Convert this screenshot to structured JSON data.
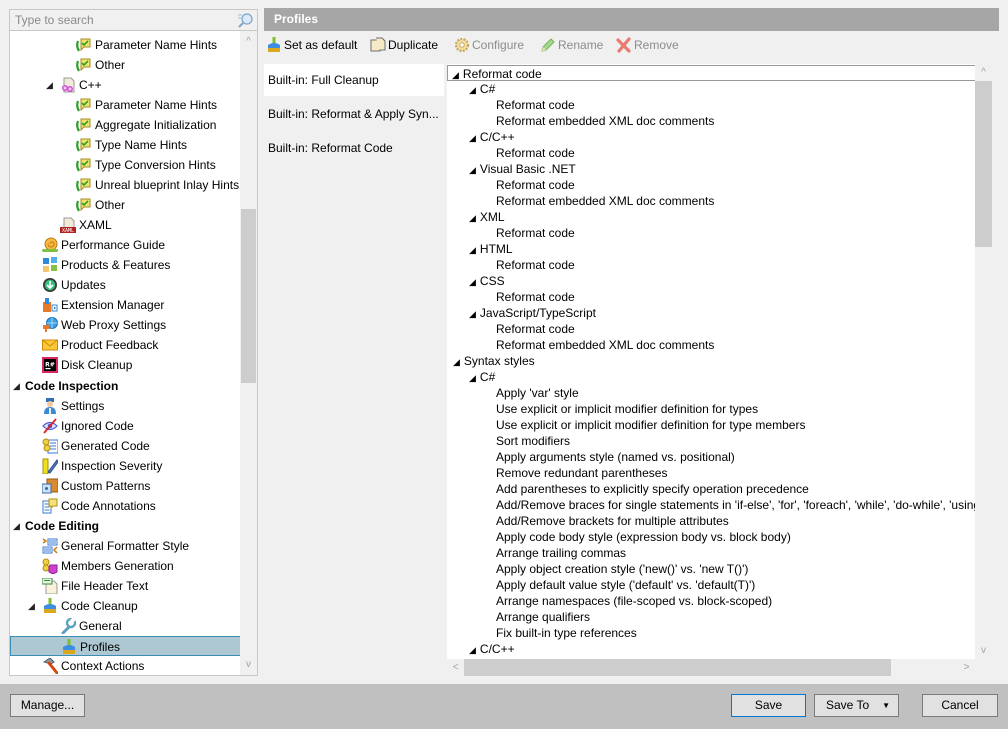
{
  "search": {
    "placeholder": "Type to search"
  },
  "tree": [
    {
      "label": "Parameter Name Hints",
      "icon": "inlay-hints-icon",
      "level": 3
    },
    {
      "label": "Other",
      "icon": "inlay-hints-icon",
      "level": 3
    },
    {
      "label": "C++",
      "icon": "cpp-file-icon",
      "level": 2,
      "expanded": true
    },
    {
      "label": "Parameter Name Hints",
      "icon": "inlay-hints-icon",
      "level": 3
    },
    {
      "label": "Aggregate Initialization",
      "icon": "inlay-hints-icon",
      "level": 3
    },
    {
      "label": "Type Name Hints",
      "icon": "inlay-hints-icon",
      "level": 3
    },
    {
      "label": "Type Conversion Hints",
      "icon": "inlay-hints-icon",
      "level": 3
    },
    {
      "label": "Unreal blueprint Inlay Hints",
      "icon": "inlay-hints-icon",
      "level": 3
    },
    {
      "label": "Other",
      "icon": "inlay-hints-icon",
      "level": 3
    },
    {
      "label": "XAML",
      "icon": "xaml-file-icon",
      "level": 2
    },
    {
      "label": "Performance Guide",
      "icon": "snail-icon",
      "level": 1
    },
    {
      "label": "Products & Features",
      "icon": "products-grid-icon",
      "level": 1
    },
    {
      "label": "Updates",
      "icon": "download-circle-icon",
      "level": 1
    },
    {
      "label": "Extension Manager",
      "icon": "extension-icon",
      "level": 1
    },
    {
      "label": "Web Proxy Settings",
      "icon": "globe-plug-icon",
      "level": 1
    },
    {
      "label": "Product Feedback",
      "icon": "envelope-icon",
      "level": 1
    },
    {
      "label": "Disk Cleanup",
      "icon": "resharper-icon",
      "level": 1
    },
    {
      "label": "Code Inspection",
      "level": 0,
      "expanded": true,
      "bold": true
    },
    {
      "label": "Settings",
      "icon": "inspector-icon",
      "level": 1
    },
    {
      "label": "Ignored Code",
      "icon": "eye-crossed-icon",
      "level": 1
    },
    {
      "label": "Generated Code",
      "icon": "generated-code-icon",
      "level": 1
    },
    {
      "label": "Inspection Severity",
      "icon": "severity-brush-icon",
      "level": 1
    },
    {
      "label": "Custom Patterns",
      "icon": "patterns-icon",
      "level": 1
    },
    {
      "label": "Code Annotations",
      "icon": "annotation-icon",
      "level": 1
    },
    {
      "label": "Code Editing",
      "level": 0,
      "expanded": true,
      "bold": true
    },
    {
      "label": "General Formatter Style",
      "icon": "formatter-icon",
      "level": 1
    },
    {
      "label": "Members Generation",
      "icon": "members-generation-icon",
      "level": 1
    },
    {
      "label": "File Header Text",
      "icon": "file-header-icon",
      "level": 1
    },
    {
      "label": "Code Cleanup",
      "icon": "broom-icon",
      "level": 1,
      "expanded": true,
      "has_arrow": true
    },
    {
      "label": "General",
      "icon": "wrench-icon",
      "level": 2
    },
    {
      "label": "Profiles",
      "icon": "broom-icon",
      "level": 2,
      "selected": true
    },
    {
      "label": "Context Actions",
      "icon": "hammer-icon",
      "level": 1
    }
  ],
  "panel": {
    "title": "Profiles"
  },
  "toolbar": {
    "set_default": "Set as default",
    "duplicate": "Duplicate",
    "configure": "Configure",
    "rename": "Rename",
    "remove": "Remove"
  },
  "profiles": [
    {
      "label": "Built-in: Full Cleanup",
      "active": true
    },
    {
      "label": "Built-in: Reformat & Apply Syn...",
      "active": false
    },
    {
      "label": "Built-in: Reformat Code",
      "active": false
    }
  ],
  "details": [
    {
      "text": "Reformat code",
      "level": 0,
      "arrow": true,
      "focused": true
    },
    {
      "text": "C#",
      "level": 1,
      "arrow": true
    },
    {
      "text": "Reformat code",
      "level": 2
    },
    {
      "text": "Reformat embedded XML doc comments",
      "level": 2
    },
    {
      "text": "C/C++",
      "level": 1,
      "arrow": true
    },
    {
      "text": "Reformat code",
      "level": 2
    },
    {
      "text": "Visual Basic .NET",
      "level": 1,
      "arrow": true
    },
    {
      "text": "Reformat code",
      "level": 2
    },
    {
      "text": "Reformat embedded XML doc comments",
      "level": 2
    },
    {
      "text": "XML",
      "level": 1,
      "arrow": true
    },
    {
      "text": "Reformat code",
      "level": 2
    },
    {
      "text": "HTML",
      "level": 1,
      "arrow": true
    },
    {
      "text": "Reformat code",
      "level": 2
    },
    {
      "text": "CSS",
      "level": 1,
      "arrow": true
    },
    {
      "text": "Reformat code",
      "level": 2
    },
    {
      "text": "JavaScript/TypeScript",
      "level": 1,
      "arrow": true
    },
    {
      "text": "Reformat code",
      "level": 2
    },
    {
      "text": "Reformat embedded XML doc comments",
      "level": 2
    },
    {
      "text": "Syntax styles",
      "level": 0,
      "arrow": true
    },
    {
      "text": "C#",
      "level": 1,
      "arrow": true
    },
    {
      "text": "Apply 'var' style",
      "level": 2
    },
    {
      "text": "Use explicit or implicit modifier definition for types",
      "level": 2
    },
    {
      "text": "Use explicit or implicit modifier definition for type members",
      "level": 2
    },
    {
      "text": "Sort modifiers",
      "level": 2
    },
    {
      "text": "Apply arguments style (named vs. positional)",
      "level": 2
    },
    {
      "text": "Remove redundant parentheses",
      "level": 2
    },
    {
      "text": "Add parentheses to explicitly specify operation precedence",
      "level": 2
    },
    {
      "text": "Add/Remove braces for single statements in 'if-else', 'for', 'foreach', 'while', 'do-while', 'using'",
      "level": 2
    },
    {
      "text": "Add/Remove brackets for multiple attributes",
      "level": 2
    },
    {
      "text": "Apply code body style (expression body vs. block body)",
      "level": 2
    },
    {
      "text": "Arrange trailing commas",
      "level": 2
    },
    {
      "text": "Apply object creation style ('new()' vs. 'new T()')",
      "level": 2
    },
    {
      "text": "Apply default value style ('default' vs. 'default(T)')",
      "level": 2
    },
    {
      "text": "Arrange namespaces (file-scoped vs. block-scoped)",
      "level": 2
    },
    {
      "text": "Arrange qualifiers",
      "level": 2
    },
    {
      "text": "Fix built-in type references",
      "level": 2
    },
    {
      "text": "C/C++",
      "level": 1,
      "arrow": true
    }
  ],
  "footer": {
    "manage": "Manage...",
    "save": "Save",
    "save_to": "Save To",
    "cancel": "Cancel"
  },
  "glyphs": {
    "expanded_arrow": "◢",
    "dropdown_arrow": "▼",
    "scroll_up": "^",
    "scroll_down": "v",
    "scroll_left": "<",
    "scroll_right": ">"
  }
}
